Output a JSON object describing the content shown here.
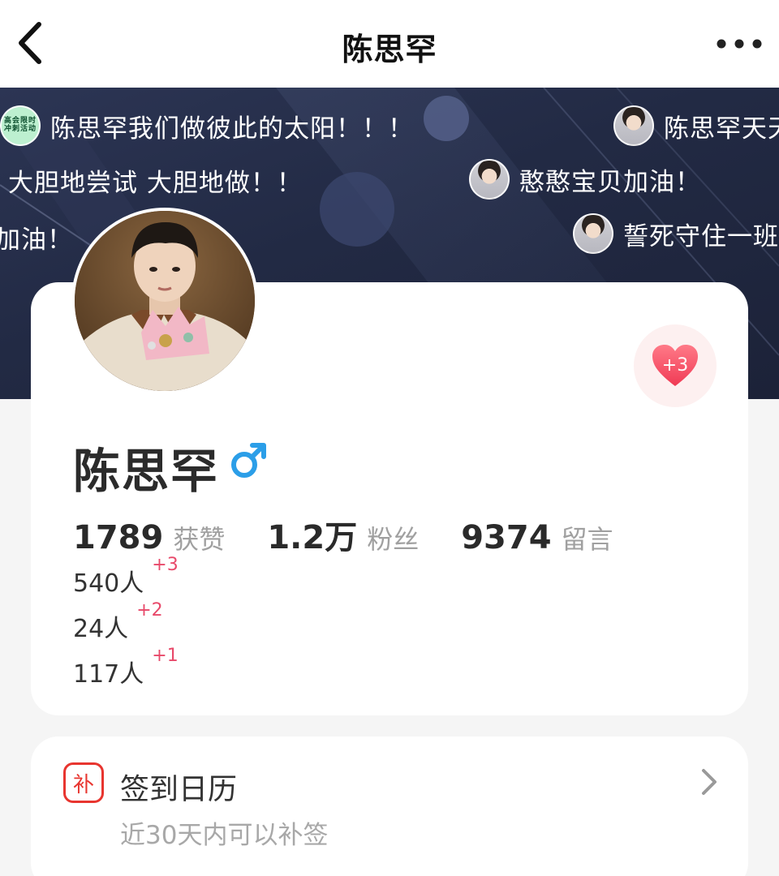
{
  "nav": {
    "title": "陈思罕",
    "back_icon": "chevron-left-icon",
    "more_icon": "more-horizontal-icon"
  },
  "danmaku": [
    {
      "text": "陈思罕我们做彼此的太阳！！！",
      "avatar": "badge",
      "badge_lines": [
        "高会限时",
        "冲刺活动"
      ]
    },
    {
      "text": "陈思罕天天",
      "avatar": "face"
    },
    {
      "text": "大胆地尝试 大胆地做！！",
      "avatar": "none"
    },
    {
      "text": "憨憨宝贝加油！",
      "avatar": "face"
    },
    {
      "text": "加油！",
      "avatar": "none"
    },
    {
      "text": "誓死守住一班",
      "avatar": "face"
    }
  ],
  "profile": {
    "name": "陈思罕",
    "gender_symbol": "♂",
    "like_button_count": "+3",
    "stats": [
      {
        "value": "1789",
        "label": "获赞"
      },
      {
        "value": "1.2万",
        "label": "粉丝"
      },
      {
        "value": "9374",
        "label": "留言"
      }
    ],
    "counts": [
      {
        "people": "540人",
        "delta": "+3"
      },
      {
        "people": "24人",
        "delta": "+2"
      },
      {
        "people": "117人",
        "delta": "+1"
      }
    ]
  },
  "calendar": {
    "icon_char": "补",
    "title": "签到日历",
    "subtitle": "近30天内可以补签"
  },
  "colors": {
    "accent_red": "#e8352f",
    "plus_pink": "#e8496a",
    "male_blue": "#2b9ee8",
    "banner_bg": "#242b46"
  }
}
